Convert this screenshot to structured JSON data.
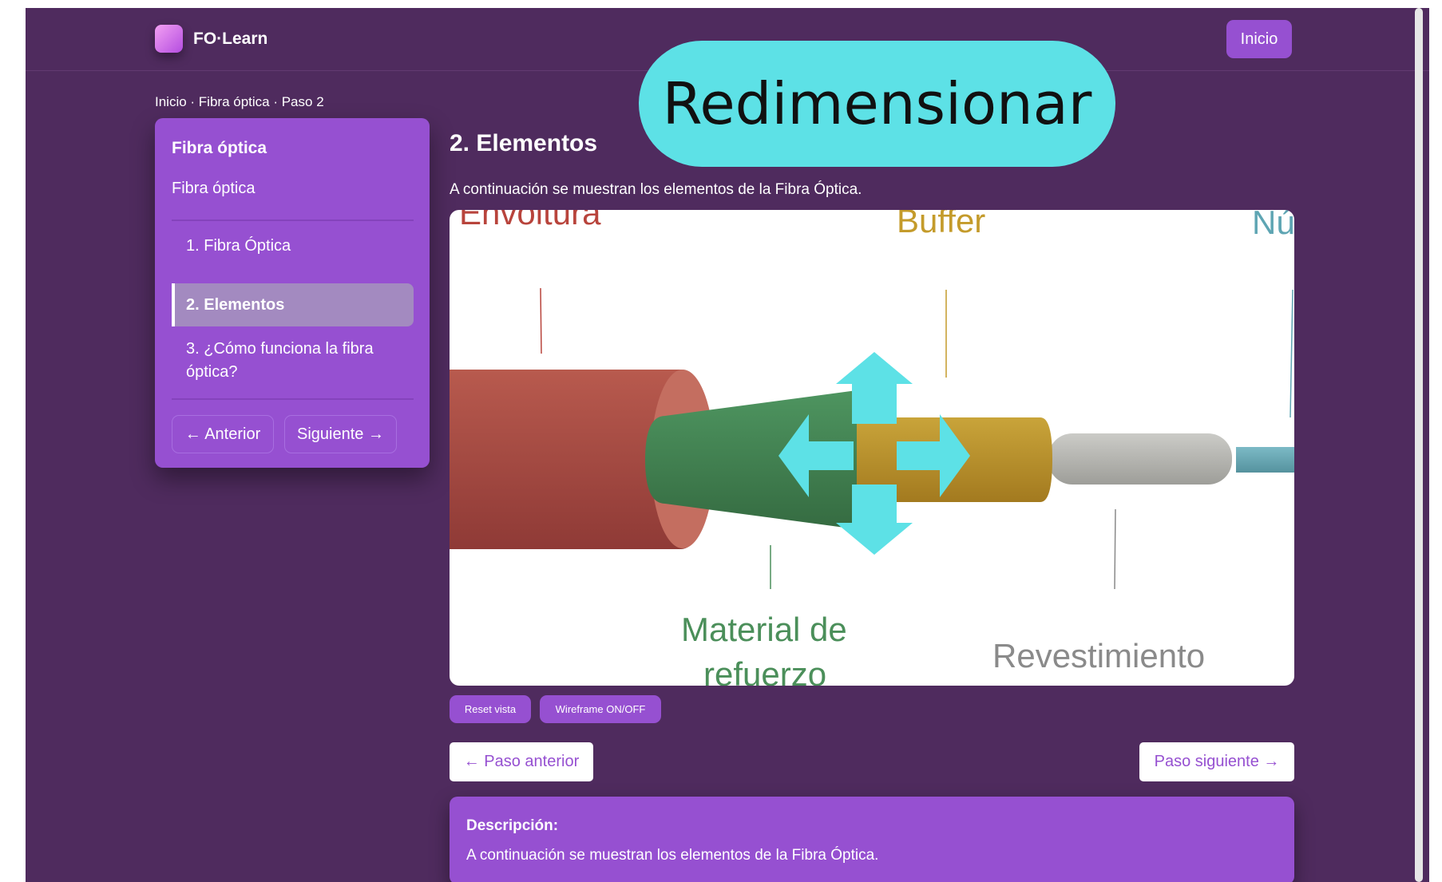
{
  "header": {
    "brand": "FO·Learn",
    "home_button": "Inicio"
  },
  "breadcrumb": "Inicio · Fibra óptica · Paso 2",
  "sidebar": {
    "title": "Fibra óptica",
    "subtitle": "Fibra óptica",
    "items": [
      {
        "label": "1. Fibra Óptica",
        "active": false
      },
      {
        "label": "2. Elementos",
        "active": true
      },
      {
        "label": "3. ¿Cómo funciona la fibra óptica?",
        "active": false
      }
    ],
    "prev_button": "← Anterior",
    "next_button": "Siguiente →"
  },
  "main": {
    "title": "2. Elementos",
    "description": "A continuación se muestran los elementos de la Fibra Óptica."
  },
  "viewer": {
    "labels": {
      "envoltura": "Envoltura",
      "buffer": "Buffer",
      "nucleo": "Núcleo",
      "material_line1": "Material de",
      "material_line2": "refuerzo",
      "revestimiento": "Revestimiento"
    },
    "colors": {
      "envoltura": "#c0544a",
      "material": "#4b8f5a",
      "buffer": "#c79d2e",
      "revestimiento": "#b9b9b5",
      "nucleo": "#6aabb8"
    }
  },
  "controls": {
    "reset": "Reset vista",
    "wireframe": "Wireframe ON/OFF"
  },
  "step_nav": {
    "prev": "← Paso anterior",
    "next": "Paso siguiente →"
  },
  "description_box": {
    "title": "Descripción:",
    "text": "A continuación se muestran los elementos de la Fibra Óptica."
  },
  "overlay": {
    "label": "Redimensionar",
    "color": "#5de1e6"
  }
}
